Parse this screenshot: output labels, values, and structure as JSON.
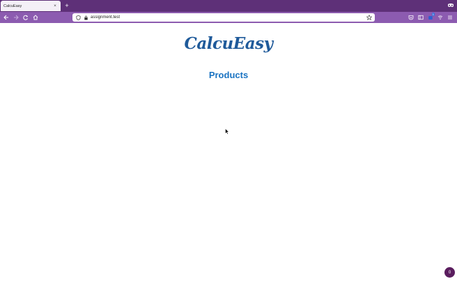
{
  "browser": {
    "tab_title": "CalcuEasy",
    "tab_close": "×",
    "new_tab": "+",
    "url": "assignment.test",
    "extension_badge": "1"
  },
  "page": {
    "logo_text": "CalcuEasy",
    "heading": "Products",
    "fab_label": "0"
  },
  "colors": {
    "titlebar": "#5e3078",
    "navbar": "#8c5bb0",
    "logo": "#1f5a9a",
    "heading": "#1a73c2",
    "fab": "#5a1d5e"
  }
}
